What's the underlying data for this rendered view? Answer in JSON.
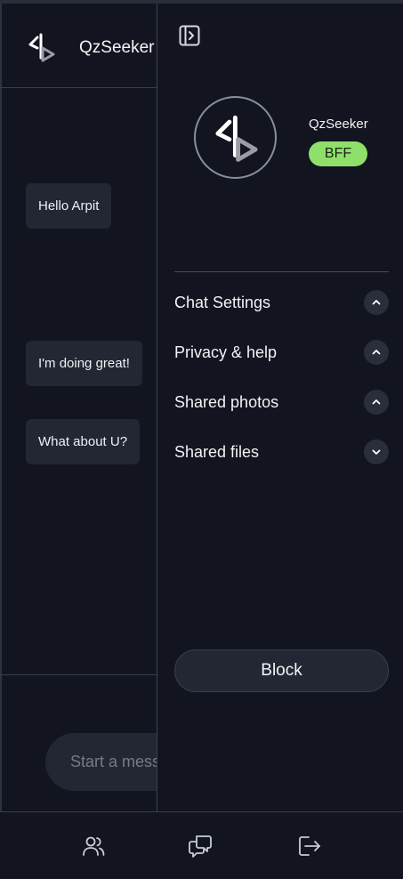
{
  "chat": {
    "title": "QzSeeker",
    "messages": [
      "Hello Arpit",
      "I'm doing great!",
      "What about U?"
    ],
    "composer_placeholder": "Start a message"
  },
  "panel": {
    "profile_name": "QzSeeker",
    "badge": "BFF",
    "sections": [
      {
        "label": "Chat Settings",
        "icon": "chevron-up-icon"
      },
      {
        "label": "Privacy & help",
        "icon": "chevron-up-icon"
      },
      {
        "label": "Shared photos",
        "icon": "chevron-up-icon"
      },
      {
        "label": "Shared files",
        "icon": "chevron-down-icon"
      }
    ],
    "block_label": "Block"
  },
  "nav": {
    "items": [
      "users-icon",
      "chats-icon",
      "logout-icon"
    ]
  },
  "colors": {
    "background": "#12141f",
    "bubble": "#232633",
    "badge": "#8ee06a"
  }
}
